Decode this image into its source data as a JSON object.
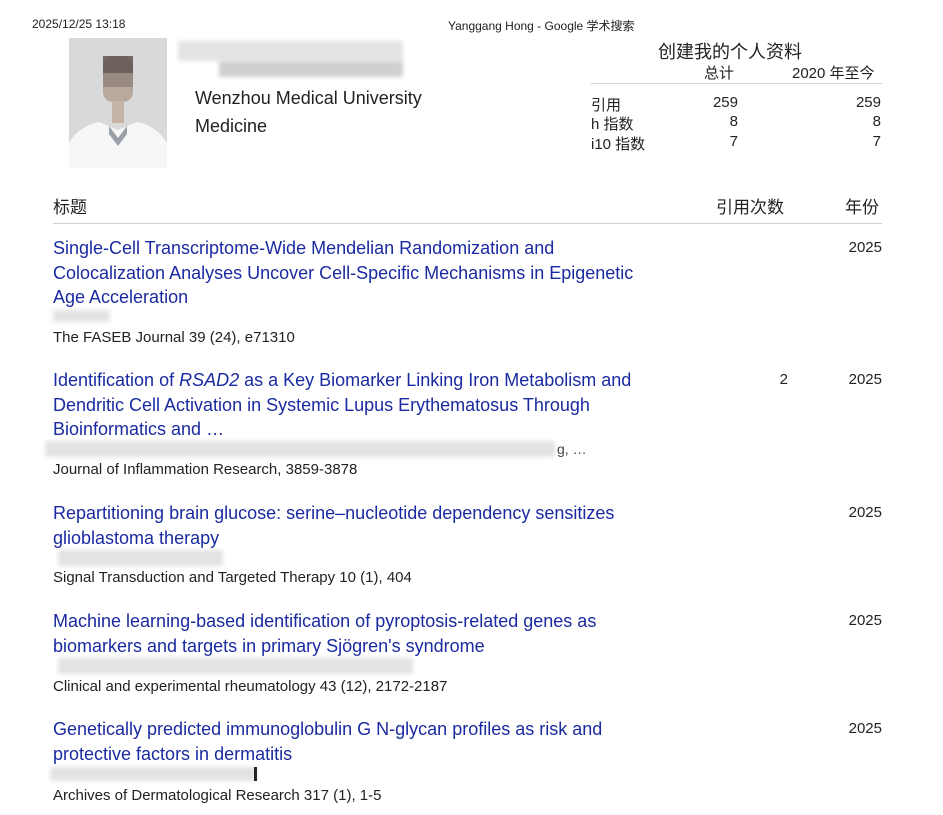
{
  "print_header": {
    "timestamp": "2025/12/25 13:18",
    "page_title": "Yanggang Hong - Google 学术搜索"
  },
  "profile": {
    "affiliation": "Wenzhou Medical University",
    "field": "Medicine",
    "create_profile_label": "创建我的个人资料"
  },
  "stats": {
    "headers": {
      "all": "总计",
      "since": "2020 年至今"
    },
    "rows": [
      {
        "label": "引用",
        "all": "259",
        "since": "259"
      },
      {
        "label": "h 指数",
        "all": "8",
        "since": "8"
      },
      {
        "label": "i10 指数",
        "all": "7",
        "since": "7"
      }
    ]
  },
  "table_headers": {
    "title": "标题",
    "cited_by": "引用次数",
    "year": "年份"
  },
  "publications": [
    {
      "title_lines": [
        "Single-Cell Transcriptome-Wide Mendelian Randomization and",
        "Colocalization Analyses Uncover Cell-Specific Mechanisms in Epigenetic",
        "Age Acceleration"
      ],
      "journal": "The FASEB Journal 39 (24), e71310",
      "cited_by": "",
      "year": "2025"
    },
    {
      "title_line1_pre": "Identification of ",
      "title_line1_em": "RSAD2",
      "title_line1_post": " as a Key Biomarker Linking Iron Metabolism and",
      "title_lines_rest": [
        "Dendritic Cell Activation in Systemic Lupus Erythematosus Through",
        "Bioinformatics and …"
      ],
      "authors_tail": "g, …",
      "journal": "Journal of Inflammation Research, 3859-3878",
      "cited_by": "2",
      "year": "2025"
    },
    {
      "title_lines": [
        "Repartitioning brain glucose: serine–nucleotide dependency sensitizes",
        "glioblastoma therapy"
      ],
      "journal": "Signal Transduction and Targeted Therapy 10 (1), 404",
      "cited_by": "",
      "year": "2025"
    },
    {
      "title_lines": [
        "Machine learning-based identification of pyroptosis-related genes as",
        "biomarkers and targets in primary Sjögren's syndrome"
      ],
      "journal": "Clinical and experimental rheumatology 43 (12), 2172-2187",
      "cited_by": "",
      "year": "2025"
    },
    {
      "title_lines": [
        "Genetically predicted immunoglobulin G N-glycan profiles as risk and",
        "protective factors in dermatitis"
      ],
      "journal": "Archives of Dermatological Research 317 (1), 1-5",
      "cited_by": "",
      "year": "2025"
    }
  ]
}
